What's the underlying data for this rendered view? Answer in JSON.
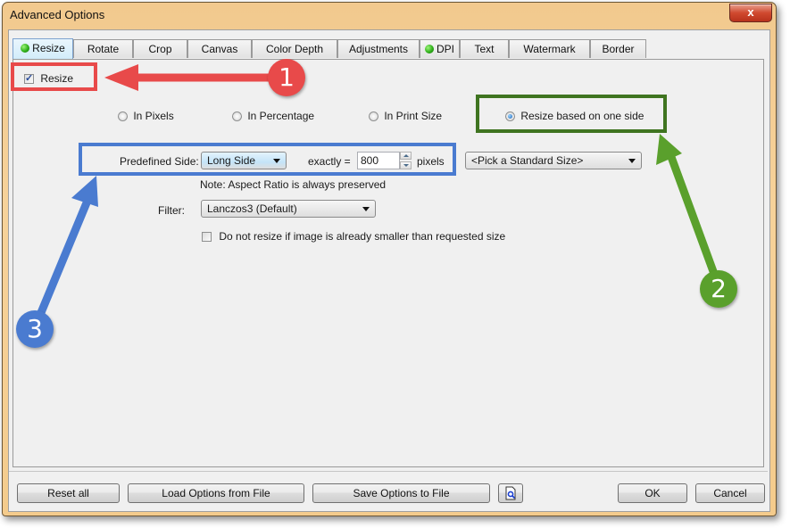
{
  "window": {
    "title": "Advanced Options",
    "close_icon": "close-x-icon",
    "close_label": "x"
  },
  "tabs": [
    {
      "label": "Resize",
      "active": true,
      "indicator": "green-dot-icon"
    },
    {
      "label": "Rotate"
    },
    {
      "label": "Crop"
    },
    {
      "label": "Canvas"
    },
    {
      "label": "Color Depth"
    },
    {
      "label": "Adjustments"
    },
    {
      "label": "DPI",
      "indicator": "green-dot-icon"
    },
    {
      "label": "Text"
    },
    {
      "label": "Watermark"
    },
    {
      "label": "Border"
    }
  ],
  "resize": {
    "enable_label": "Resize",
    "enable_checked": true,
    "modes": [
      {
        "label": "In Pixels",
        "checked": false
      },
      {
        "label": "In Percentage",
        "checked": false
      },
      {
        "label": "In Print Size",
        "checked": false
      },
      {
        "label": "Resize based on one side",
        "checked": true
      }
    ],
    "predefined_side_label": "Predefined Side:",
    "predefined_side_value": "Long Side",
    "exactly_label": "exactly =",
    "exactly_value": "800",
    "pixels_label": "pixels",
    "standard_size_value": "<Pick a Standard Size>",
    "note": "Note: Aspect Ratio is always preserved",
    "filter_label": "Filter:",
    "filter_value": "Lanczos3 (Default)",
    "no_upscale_label": "Do not resize if image is already smaller than requested size",
    "no_upscale_checked": false
  },
  "footer": {
    "reset_all": "Reset all",
    "load_options": "Load Options from File",
    "save_options": "Save Options to File",
    "preview_icon": "document-magnifier-icon",
    "ok": "OK",
    "cancel": "Cancel"
  },
  "annotations": [
    {
      "number": "1",
      "color": "#e84a4a"
    },
    {
      "number": "2",
      "color": "#5aa02c"
    },
    {
      "number": "3",
      "color": "#4a7bd0"
    }
  ]
}
